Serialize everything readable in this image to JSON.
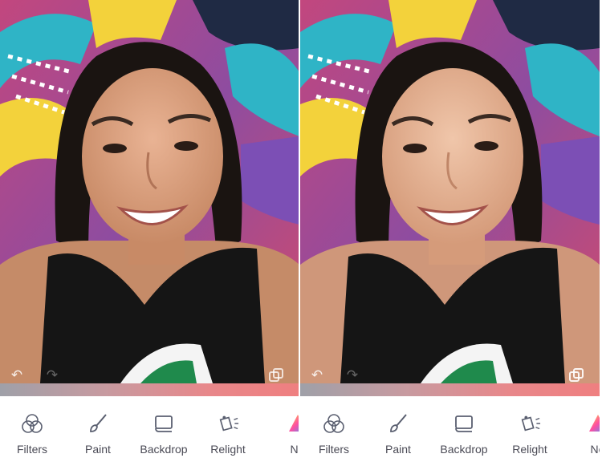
{
  "toolbar": {
    "items": [
      {
        "label": "Filters",
        "icon": "filters-icon"
      },
      {
        "label": "Paint",
        "icon": "brush-icon"
      },
      {
        "label": "Backdrop",
        "icon": "backdrop-icon"
      },
      {
        "label": "Relight",
        "icon": "relight-icon"
      },
      {
        "label": "Ne",
        "icon": "neon-icon"
      }
    ]
  },
  "overlay_controls": {
    "left": [
      "undo-icon",
      "redo-icon",
      "compare-icon"
    ],
    "right": [
      "undo-icon",
      "redo-icon",
      "compare-icon"
    ]
  },
  "colors": {
    "bar_start": "#9fa0a8",
    "bar_end": "#ef7f80",
    "toolbar_text": "#4a4a55"
  }
}
